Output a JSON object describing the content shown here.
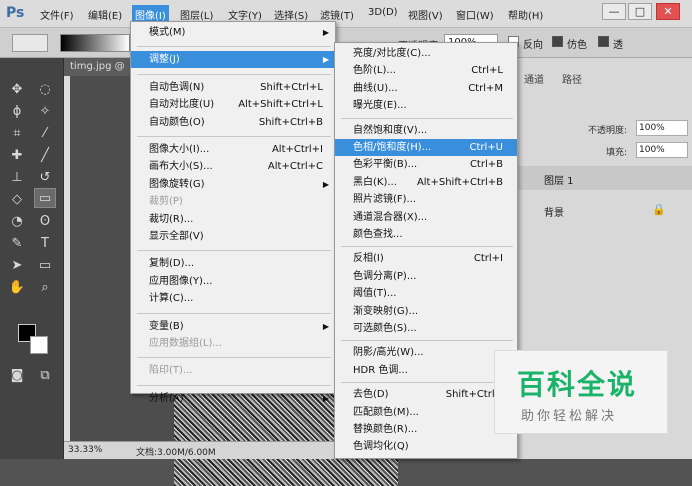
{
  "menubar": {
    "logo": "Ps",
    "items": [
      "文件(F)",
      "编辑(E)",
      "图像(I)",
      "图层(L)",
      "文字(Y)",
      "选择(S)",
      "滤镜(T)",
      "3D(D)",
      "视图(V)",
      "窗口(W)",
      "帮助(H)"
    ],
    "active_index": 2,
    "win_min": "—",
    "win_max": "□",
    "win_close": "✕"
  },
  "options": {
    "opacity_label": "不透明度:",
    "opacity_value": "100%",
    "reverse_label": "反向",
    "dither_label": "仿色",
    "transparency_label": "透"
  },
  "document": {
    "tab": "timg.jpg @"
  },
  "status": {
    "zoom": "33.33%",
    "doc_size": "文档:3.00M/6.00M"
  },
  "image_menu": [
    {
      "label": "模式(M)",
      "sub": true
    },
    {
      "sep": true
    },
    {
      "label": "调整(J)",
      "sub": true,
      "hl": true
    },
    {
      "sep": true
    },
    {
      "label": "自动色调(N)",
      "sc": "Shift+Ctrl+L"
    },
    {
      "label": "自动对比度(U)",
      "sc": "Alt+Shift+Ctrl+L"
    },
    {
      "label": "自动颜色(O)",
      "sc": "Shift+Ctrl+B"
    },
    {
      "sep": true
    },
    {
      "label": "图像大小(I)...",
      "sc": "Alt+Ctrl+I"
    },
    {
      "label": "画布大小(S)...",
      "sc": "Alt+Ctrl+C"
    },
    {
      "label": "图像旋转(G)",
      "sub": true
    },
    {
      "label": "裁剪(P)",
      "dis": true
    },
    {
      "label": "裁切(R)..."
    },
    {
      "label": "显示全部(V)"
    },
    {
      "sep": true
    },
    {
      "label": "复制(D)..."
    },
    {
      "label": "应用图像(Y)..."
    },
    {
      "label": "计算(C)..."
    },
    {
      "sep": true
    },
    {
      "label": "变量(B)",
      "sub": true
    },
    {
      "label": "应用数据组(L)...",
      "dis": true
    },
    {
      "sep": true
    },
    {
      "label": "陷印(T)...",
      "dis": true
    },
    {
      "sep": true
    },
    {
      "label": "分析(A)",
      "sub": true
    }
  ],
  "adjust_menu": [
    {
      "label": "亮度/对比度(C)..."
    },
    {
      "label": "色阶(L)...",
      "sc": "Ctrl+L"
    },
    {
      "label": "曲线(U)...",
      "sc": "Ctrl+M"
    },
    {
      "label": "曝光度(E)..."
    },
    {
      "sep": true
    },
    {
      "label": "自然饱和度(V)..."
    },
    {
      "label": "色相/饱和度(H)...",
      "sc": "Ctrl+U",
      "hl": true
    },
    {
      "label": "色彩平衡(B)...",
      "sc": "Ctrl+B"
    },
    {
      "label": "黑白(K)...",
      "sc": "Alt+Shift+Ctrl+B"
    },
    {
      "label": "照片滤镜(F)..."
    },
    {
      "label": "通道混合器(X)..."
    },
    {
      "label": "颜色查找..."
    },
    {
      "sep": true
    },
    {
      "label": "反相(I)",
      "sc": "Ctrl+I"
    },
    {
      "label": "色调分离(P)..."
    },
    {
      "label": "阈值(T)..."
    },
    {
      "label": "渐变映射(G)..."
    },
    {
      "label": "可选颜色(S)..."
    },
    {
      "sep": true
    },
    {
      "label": "阴影/高光(W)..."
    },
    {
      "label": "HDR 色调..."
    },
    {
      "sep": true
    },
    {
      "label": "去色(D)",
      "sc": "Shift+Ctrl+"
    },
    {
      "label": "匹配颜色(M)..."
    },
    {
      "label": "替换颜色(R)..."
    },
    {
      "label": "色调均化(Q)"
    }
  ],
  "panels": {
    "tabs": [
      "通道",
      "路径"
    ],
    "opacity_label": "不透明度:",
    "opacity_value": "100%",
    "fill_label": "填充:",
    "fill_value": "100%",
    "layers": [
      {
        "name": "图层 1"
      },
      {
        "name": "背景"
      }
    ]
  },
  "watermark": {
    "title": "百科全说",
    "subtitle": "助你轻松解决"
  }
}
